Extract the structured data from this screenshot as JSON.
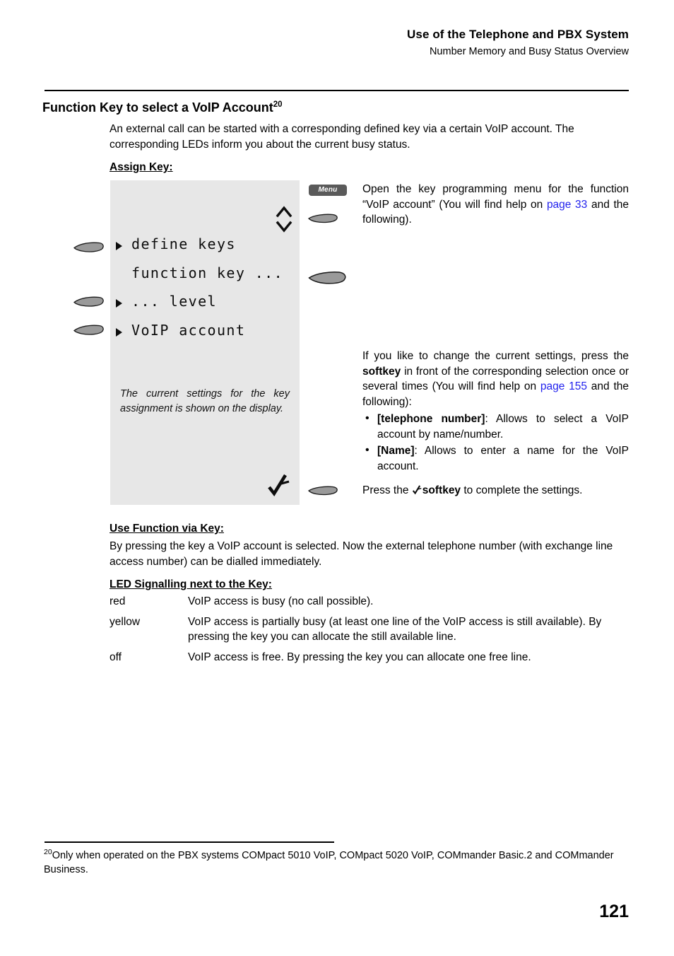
{
  "header": {
    "title": "Use of the Telephone and PBX System",
    "subtitle": "Number Memory and Busy Status Overview"
  },
  "section": {
    "title": "Function Key to select a VoIP Account",
    "footnote_marker": "20",
    "intro": "An external call can be started with a corresponding defined key via a certain VoIP account. The corresponding LEDs inform you about the current busy status.",
    "assign_key_heading": "Assign Key:"
  },
  "display": {
    "lines": [
      {
        "arrow": true,
        "text": "define keys"
      },
      {
        "arrow": false,
        "text": "function key ..."
      },
      {
        "arrow": true,
        "text": "... level"
      },
      {
        "arrow": true,
        "text": "VoIP account"
      }
    ],
    "note": "The current settings for the key assignment is shown on the display.",
    "check_icon": "check-icon",
    "scroll_icons": "scroll-up-down-icon",
    "background": "#e7e7e7"
  },
  "controls": {
    "menu_button_label": "Menu",
    "softkey_icon": "softkey-icon"
  },
  "explanations": {
    "para1_pre": "Open the key programming menu for the function “VoIP account” (You will find help on ",
    "para1_link": "page 33",
    "para1_post": " and the following).",
    "para2_a": "If you like to change the current settings, press the ",
    "para2_bold": "softkey",
    "para2_b": " in front of the corresponding selection once or several times (You will find help on ",
    "para2_link": "page 155",
    "para2_c": " and the following):",
    "bullets": [
      {
        "label": "[telephone number]",
        "text": ": Allows to select a VoIP account by name/number."
      },
      {
        "label": "[Name]",
        "text": ": Allows to enter a name for the VoIP account."
      }
    ],
    "para3_a": "Press the ",
    "para3_bold": "softkey",
    "para3_b": " to complete the settings."
  },
  "use_function": {
    "heading": "Use Function via Key:",
    "text": "By pressing the key a VoIP account is selected. Now the external telephone number (with exchange line access number) can be dialled immediately."
  },
  "led": {
    "heading": "LED Signalling next to the Key:",
    "rows": [
      {
        "color": "red",
        "description": "VoIP access is busy (no call possible)."
      },
      {
        "color": "yellow",
        "description": "VoIP access is partially busy (at least one line of the VoIP access is still available). By pressing the key you can allocate the still available line."
      },
      {
        "color": "off",
        "description": "VoIP access is free. By pressing the key you can allocate one free line."
      }
    ]
  },
  "footnote": {
    "marker": "20",
    "text": "Only when operated on the PBX systems COMpact 5010 VoIP, COMpact 5020 VoIP, COMmander Basic.2 and COMmander Business."
  },
  "page_number": "121"
}
